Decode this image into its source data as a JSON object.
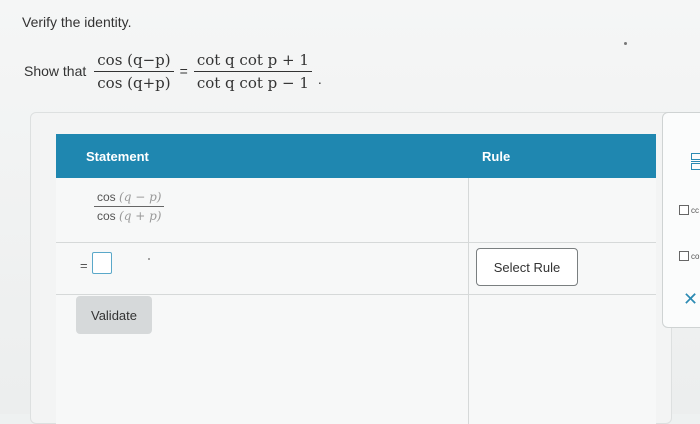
{
  "question": {
    "title": "Verify the identity.",
    "prompt_prefix": "Show that",
    "lhs_num": "cos (q−p)",
    "lhs_den": "cos (q+p)",
    "equals": "=",
    "rhs_num": "cot q cot p + 1",
    "rhs_den": "cot q cot p − 1",
    "end": "."
  },
  "table": {
    "header_statement": "Statement",
    "header_rule": "Rule",
    "row1": {
      "num_fn": "cos",
      "num_arg": "(q − p)",
      "den_fn": "cos",
      "den_arg": "(q + p)"
    },
    "row2_equals": "=",
    "select_rule_label": "Select Rule",
    "validate_label": "Validate"
  },
  "side_panel": {
    "top_icon": "fraction-icon",
    "item1_label": "cc",
    "item2_label": "co",
    "close_icon": "close-icon",
    "close_glyph": "✕"
  }
}
